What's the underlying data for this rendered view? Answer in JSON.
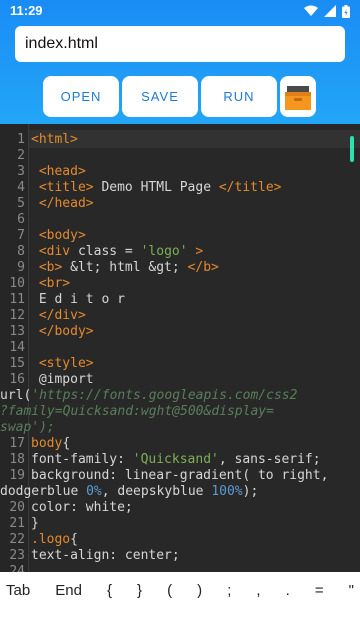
{
  "status": {
    "time": "11:29"
  },
  "file": {
    "name": "index.html"
  },
  "toolbar": {
    "open_label": "OPEN",
    "save_label": "SAVE",
    "run_label": "RUN",
    "box_icon": "box-icon"
  },
  "editor": {
    "lines": [
      {
        "n": "1",
        "segs": [
          {
            "t": "<html>",
            "c": "tag"
          }
        ]
      },
      {
        "n": "2",
        "segs": []
      },
      {
        "n": "3",
        "segs": [
          {
            "t": " <head>",
            "c": "tag"
          }
        ]
      },
      {
        "n": "4",
        "segs": [
          {
            "t": " <title>",
            "c": "tag"
          },
          {
            "t": " Demo HTML Page ",
            "c": "com"
          },
          {
            "t": "</title>",
            "c": "tag"
          }
        ]
      },
      {
        "n": "5",
        "segs": [
          {
            "t": " </head>",
            "c": "tag"
          }
        ]
      },
      {
        "n": "6",
        "segs": []
      },
      {
        "n": "7",
        "segs": [
          {
            "t": " <body>",
            "c": "tag"
          }
        ]
      },
      {
        "n": "8",
        "segs": [
          {
            "t": " <div ",
            "c": "tag"
          },
          {
            "t": "class = ",
            "c": "com"
          },
          {
            "t": "'logo'",
            "c": "str"
          },
          {
            "t": " >",
            "c": "tag"
          }
        ]
      },
      {
        "n": "9",
        "segs": [
          {
            "t": " <b>",
            "c": "tag"
          },
          {
            "t": " &lt; html &gt; ",
            "c": "com"
          },
          {
            "t": "</b>",
            "c": "tag"
          }
        ]
      },
      {
        "n": "10",
        "segs": [
          {
            "t": " <br>",
            "c": "tag"
          }
        ]
      },
      {
        "n": "11",
        "segs": [
          {
            "t": " E d i t o r",
            "c": "com"
          }
        ]
      },
      {
        "n": "12",
        "segs": [
          {
            "t": " </div>",
            "c": "tag"
          }
        ]
      },
      {
        "n": "13",
        "segs": [
          {
            "t": " </body>",
            "c": "tag"
          }
        ]
      },
      {
        "n": "14",
        "segs": []
      },
      {
        "n": "15",
        "segs": [
          {
            "t": " <style>",
            "c": "tag"
          }
        ]
      },
      {
        "n": "16",
        "segs": [
          {
            "t": " @import",
            "c": "com"
          }
        ]
      },
      {
        "n": "",
        "wrap": true,
        "segs": [
          {
            "t": "url(",
            "c": "com"
          },
          {
            "t": "'https://fonts.googleapis.com/css2",
            "c": "it"
          }
        ]
      },
      {
        "n": "",
        "wrap": true,
        "segs": [
          {
            "t": "?family=Quicksand:wght@500&display=",
            "c": "it"
          }
        ]
      },
      {
        "n": "",
        "wrap": true,
        "segs": [
          {
            "t": "swap');",
            "c": "it"
          }
        ]
      },
      {
        "n": "17",
        "segs": [
          {
            "t": "body",
            "c": "tag"
          },
          {
            "t": "{",
            "c": "com"
          }
        ]
      },
      {
        "n": "18",
        "segs": [
          {
            "t": "font-family: ",
            "c": "com"
          },
          {
            "t": "'Quicksand'",
            "c": "str"
          },
          {
            "t": ", sans-serif;",
            "c": "com"
          }
        ]
      },
      {
        "n": "19",
        "segs": [
          {
            "t": "background: linear-gradient( to right,",
            "c": "com"
          }
        ]
      },
      {
        "n": "",
        "wrap": true,
        "segs": [
          {
            "t": "dodgerblue ",
            "c": "com"
          },
          {
            "t": "0%",
            "c": "num"
          },
          {
            "t": ", deepskyblue ",
            "c": "com"
          },
          {
            "t": "100%",
            "c": "num"
          },
          {
            "t": ");",
            "c": "com"
          }
        ]
      },
      {
        "n": "20",
        "segs": [
          {
            "t": "color: white;",
            "c": "com"
          }
        ]
      },
      {
        "n": "21",
        "segs": [
          {
            "t": "}",
            "c": "com"
          }
        ]
      },
      {
        "n": "22",
        "segs": [
          {
            "t": ".logo",
            "c": "tag"
          },
          {
            "t": "{",
            "c": "com"
          }
        ]
      },
      {
        "n": "23",
        "segs": [
          {
            "t": "text-align: center;",
            "c": "com"
          }
        ]
      },
      {
        "n": "24",
        "segs": []
      }
    ]
  },
  "keys": [
    "Tab",
    "End",
    "{",
    "}",
    "(",
    ")",
    ";",
    ",",
    ".",
    "=",
    "\""
  ]
}
